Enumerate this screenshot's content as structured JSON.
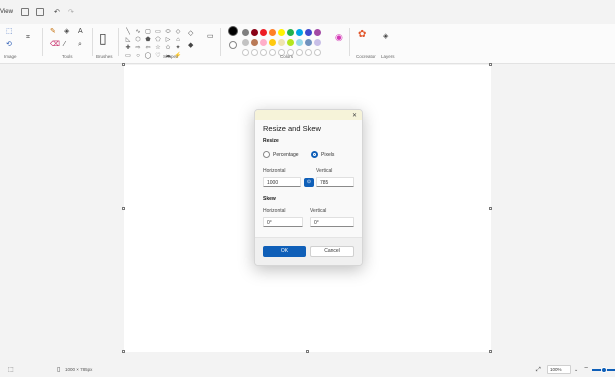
{
  "titlebar": {
    "menu_view": "View"
  },
  "ribbon": {
    "groups": {
      "image": "Image",
      "tools": "Tools",
      "brushes": "Brushes",
      "shapes": "Shapes",
      "colors": "Colors",
      "cocreator": "Cocreator",
      "layers": "Layers"
    },
    "shape_icons": [
      "╲",
      "∿",
      "▢",
      "▭",
      "⬭",
      "◇",
      "◺",
      "⬡",
      "⬟",
      "⬠",
      "▷",
      "⌂",
      "✚",
      "⇨",
      "⇦",
      "☆",
      "✩",
      "✦",
      "▭",
      "○",
      "◯",
      "♡",
      "☁",
      "⚡"
    ],
    "palette_row1": [
      "#000000",
      "#7f7f7f",
      "#880015",
      "#ed1c24",
      "#ff7f27",
      "#fff200",
      "#22b14c",
      "#00a2e8",
      "#3f48cc",
      "#a349a4"
    ],
    "palette_row2": [
      "#ffffff",
      "#c3c3c3",
      "#b97a57",
      "#ffaec9",
      "#ffc90e",
      "#efe4b0",
      "#b5e61d",
      "#99d9ea",
      "#7092be",
      "#c8bfe7"
    ]
  },
  "dialog": {
    "title": "Resize and Skew",
    "resize_section": "Resize",
    "option_percentage": "Percentage",
    "option_pixels": "Pixels",
    "horizontal_label": "Horizontal",
    "vertical_label": "Vertical",
    "resize_horizontal_value": "1000",
    "resize_vertical_value": "785",
    "skew_section": "Skew",
    "skew_horizontal_label": "Horizontal",
    "skew_vertical_label": "Vertical",
    "skew_horizontal_value": "0°",
    "skew_vertical_value": "0°",
    "ok_label": "OK",
    "cancel_label": "Cancel",
    "close_glyph": "✕",
    "lock_glyph": "⊙"
  },
  "status": {
    "canvas_size": "1000 × 785px",
    "zoom": "100%"
  },
  "colors": {
    "accent": "#0f5fb8"
  }
}
